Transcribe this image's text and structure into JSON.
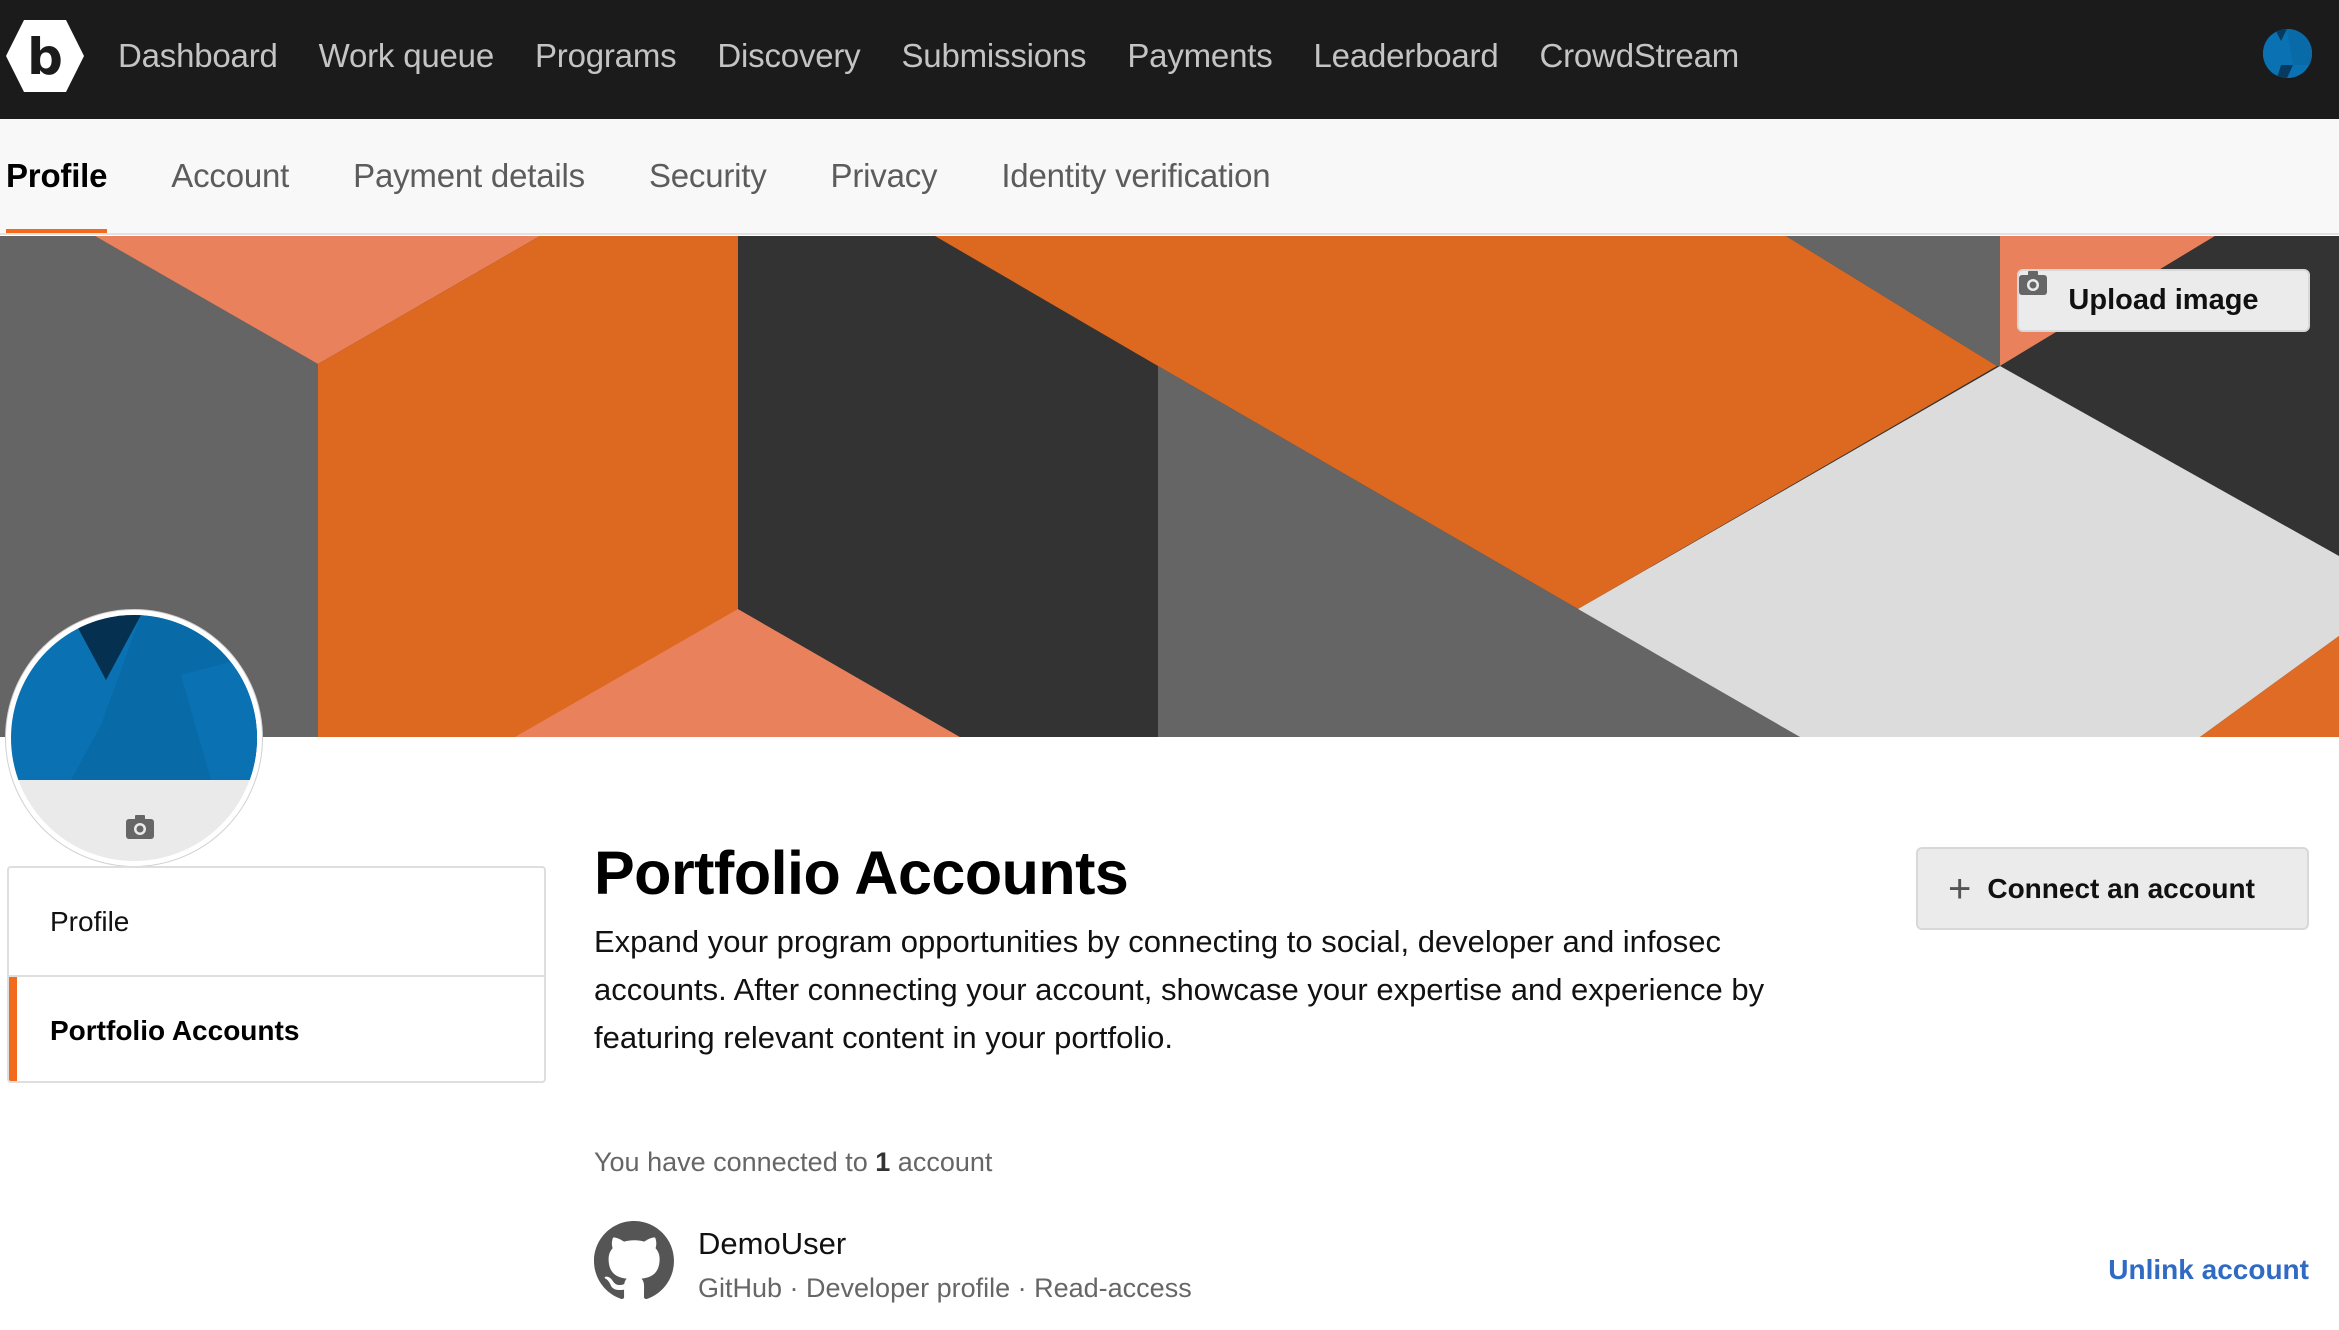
{
  "topnav": {
    "logo_letter": "b",
    "items": [
      {
        "label": "Dashboard"
      },
      {
        "label": "Work queue"
      },
      {
        "label": "Programs"
      },
      {
        "label": "Discovery"
      },
      {
        "label": "Submissions"
      },
      {
        "label": "Payments"
      },
      {
        "label": "Leaderboard"
      },
      {
        "label": "CrowdStream"
      }
    ],
    "avatar_icon": "user-avatar"
  },
  "subnav": {
    "tabs": [
      {
        "label": "Profile",
        "active": true
      },
      {
        "label": "Account",
        "active": false
      },
      {
        "label": "Payment details",
        "active": false
      },
      {
        "label": "Security",
        "active": false
      },
      {
        "label": "Privacy",
        "active": false
      },
      {
        "label": "Identity verification",
        "active": false
      }
    ]
  },
  "banner": {
    "upload_label": "Upload image",
    "upload_icon": "camera-icon"
  },
  "sidemenu": {
    "items": [
      {
        "label": "Profile",
        "active": false
      },
      {
        "label": "Portfolio Accounts",
        "active": true
      }
    ]
  },
  "main": {
    "title": "Portfolio Accounts",
    "description": "Expand your program opportunities by connecting to social, developer and infosec accounts. After connecting your account, showcase your expertise and experience by featuring relevant content in your portfolio.",
    "connect_button": {
      "icon": "plus-icon",
      "label": "Connect an account"
    },
    "count_prefix": "You have connected to",
    "count_value": "1",
    "count_suffix": "account",
    "accounts": [
      {
        "name": "DemoUser",
        "icon": "github-icon",
        "meta": "GitHub · Developer profile · Read-access",
        "unlink_label": "Unlink account"
      }
    ]
  },
  "colors": {
    "accent": "#f26a1b",
    "nav_bg": "#1b1b1b",
    "link": "#2f6ac3",
    "avatar_blue": "#0a72b3"
  }
}
